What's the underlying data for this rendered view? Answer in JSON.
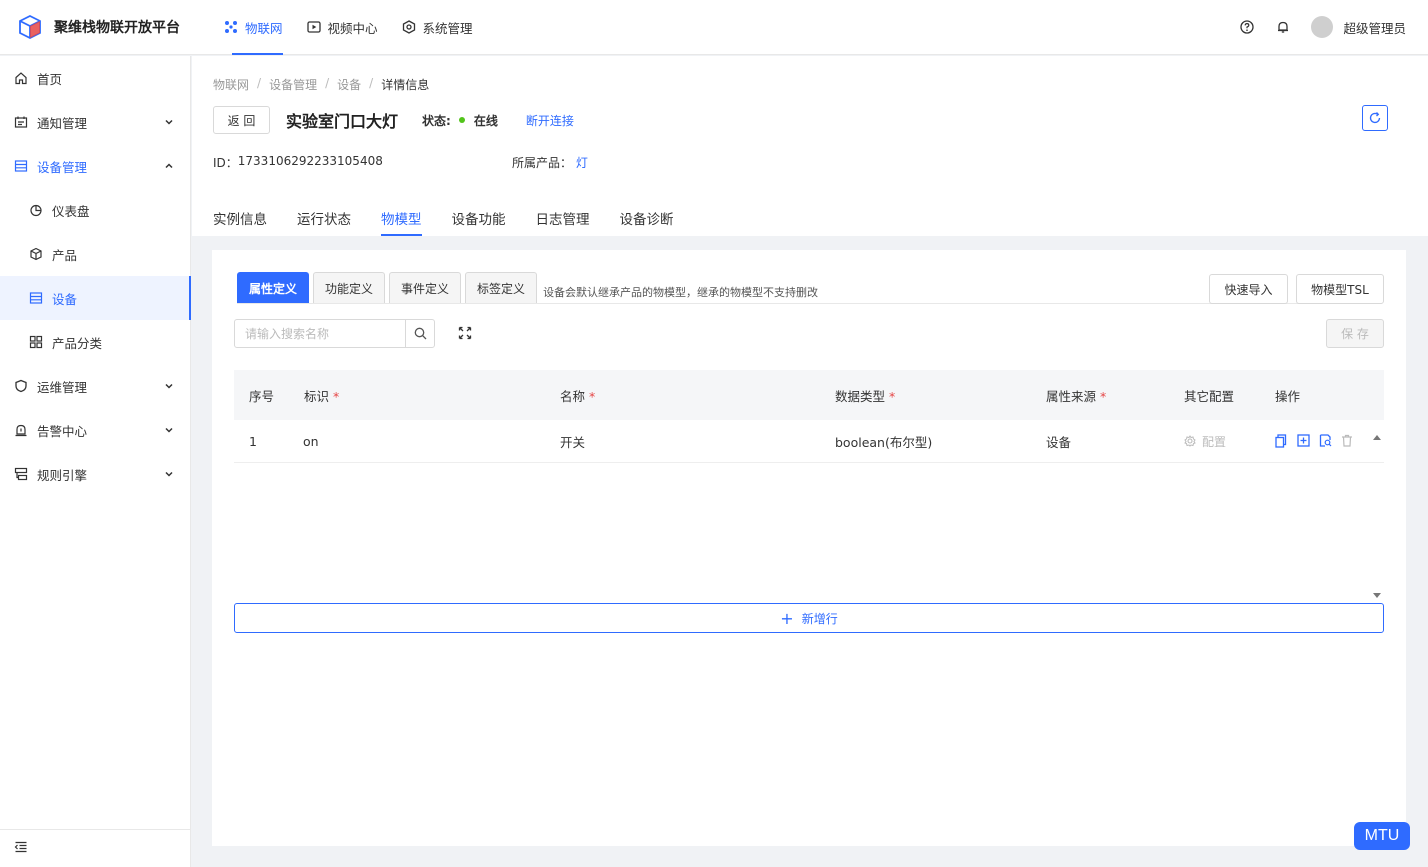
{
  "header": {
    "logo_text": "聚维栈物联开放平台",
    "nav": [
      {
        "label": "物联网",
        "icon": "iot-icon",
        "active": true
      },
      {
        "label": "视频中心",
        "icon": "video-icon",
        "active": false
      },
      {
        "label": "系统管理",
        "icon": "system-icon",
        "active": false
      }
    ],
    "user_name": "超级管理员"
  },
  "sidebar": {
    "items": [
      {
        "label": "首页"
      },
      {
        "label": "通知管理"
      },
      {
        "label": "设备管理"
      },
      {
        "label": "仪表盘"
      },
      {
        "label": "产品"
      },
      {
        "label": "设备"
      },
      {
        "label": "产品分类"
      },
      {
        "label": "运维管理"
      },
      {
        "label": "告警中心"
      },
      {
        "label": "规则引擎"
      }
    ]
  },
  "breadcrumb": [
    "物联网",
    "设备管理",
    "设备",
    "详情信息"
  ],
  "device": {
    "back_label": "返 回",
    "title": "实验室门口大灯",
    "status_label": "状态:",
    "status_value": "在线",
    "disconnect_label": "断开连接",
    "id_label": "ID：",
    "id_value": "1733106292233105408",
    "product_label": "所属产品：",
    "product_value": "灯"
  },
  "tabs": [
    "实例信息",
    "运行状态",
    "物模型",
    "设备功能",
    "日志管理",
    "设备诊断"
  ],
  "model": {
    "sub_tabs": [
      "属性定义",
      "功能定义",
      "事件定义",
      "标签定义"
    ],
    "hint": "设备会默认继承产品的物模型，继承的物模型不支持删改",
    "quick_import": "快速导入",
    "tsl": "物模型TSL",
    "search_placeholder": "请输入搜索名称",
    "save_label": "保 存",
    "columns": [
      "序号",
      "标识",
      "名称",
      "数据类型",
      "属性来源",
      "其它配置",
      "操作"
    ],
    "rows": [
      {
        "index": "1",
        "id": "on",
        "name": "开关",
        "type": "boolean(布尔型)",
        "source": "设备",
        "config": "配置"
      }
    ],
    "add_row_label": "新增行"
  },
  "badge": "MTU",
  "colors": {
    "accent": "#2f6bff",
    "online": "#52c41a"
  }
}
